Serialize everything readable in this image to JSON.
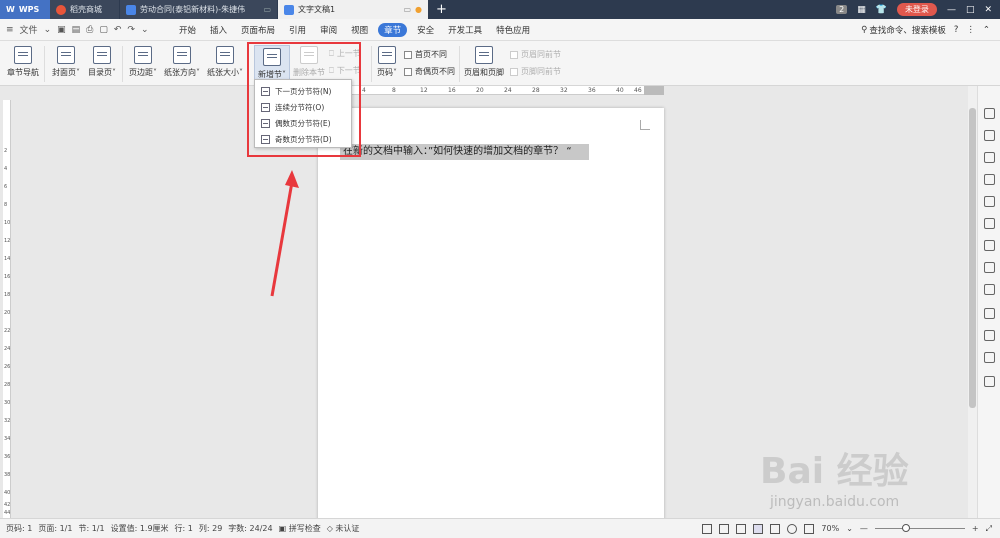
{
  "titlebar": {
    "tabs": [
      {
        "label": "WPS"
      },
      {
        "label": "稻壳商城"
      },
      {
        "label": "劳动合同(泰铝新材料)-朱捷伟"
      },
      {
        "label": "文字文稿1"
      }
    ],
    "badge": "2",
    "login_label": "未登录"
  },
  "menubar": {
    "file_label": "文件",
    "menus": [
      "开始",
      "插入",
      "页面布局",
      "引用",
      "审阅",
      "视图",
      "章节",
      "安全",
      "开发工具",
      "特色应用"
    ],
    "active_menu": "章节",
    "search_label": "查找命令、搜索模板"
  },
  "ribbon": {
    "buttons": [
      {
        "label": "章节导航"
      },
      {
        "label": "封面页"
      },
      {
        "label": "目录页"
      },
      {
        "label": "页边距"
      },
      {
        "label": "纸张方向"
      },
      {
        "label": "纸张大小"
      },
      {
        "label": "新增节"
      },
      {
        "label": "删除本节"
      },
      {
        "label": "上一节"
      },
      {
        "label": "下一节"
      },
      {
        "label": "页码"
      },
      {
        "label": "页眉和页脚"
      }
    ],
    "checks": [
      {
        "label": "首页不同"
      },
      {
        "label": "奇偶页不同"
      },
      {
        "label": "页眉同前节"
      },
      {
        "label": "页脚同前节"
      }
    ]
  },
  "ruler": {
    "h_ticks": [
      "4",
      "8",
      "12",
      "16",
      "20",
      "24",
      "28",
      "32",
      "36",
      "40",
      "46"
    ],
    "v_ticks": [
      "2",
      "4",
      "6",
      "8",
      "10",
      "12",
      "14",
      "16",
      "18",
      "20",
      "22",
      "24",
      "26",
      "28",
      "30",
      "32",
      "34",
      "36",
      "38",
      "40",
      "42",
      "44"
    ]
  },
  "dropdown": {
    "items": [
      {
        "label": "下一页分节符(N)"
      },
      {
        "label": "连续分节符(O)"
      },
      {
        "label": "偶数页分节符(E)"
      },
      {
        "label": "奇数页分节符(D)"
      }
    ]
  },
  "document": {
    "text": "在新的文档中输入：”如何快速的增加文档的章节？ “"
  },
  "statusbar": {
    "page": "页码: 1",
    "pages": "页面: 1/1",
    "section": "节: 1/1",
    "setting": "设置值: 1.9厘米",
    "row": "行: 1",
    "col": "列: 29",
    "words": "字数: 24/24",
    "spell": "拼写检查",
    "cert": "未认证",
    "zoom": "70%",
    "zoom_fraction": 0.35
  },
  "watermark": {
    "brand": "Bai 经验",
    "url": "jingyan.baidu.com"
  },
  "colors": {
    "accent": "#3b78d8",
    "highlight": "#e8383d",
    "login": "#e0584d"
  }
}
